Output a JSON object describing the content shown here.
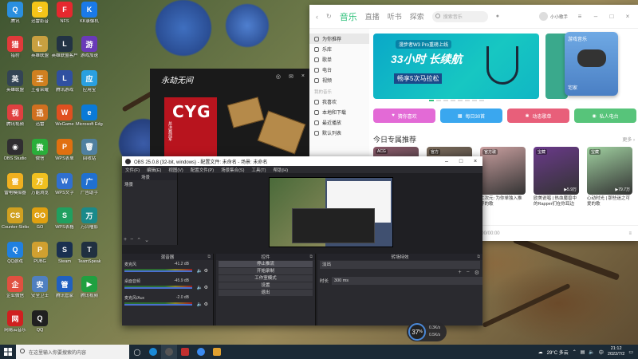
{
  "desktop": {
    "icons": [
      {
        "label": "腾讯",
        "color": "#2a8fe0",
        "glyph": "Q"
      },
      {
        "label": "迅雷影音",
        "color": "#f5c518",
        "glyph": "S"
      },
      {
        "label": "NFS",
        "color": "#e5282e",
        "glyph": "F"
      },
      {
        "label": "KK录像机",
        "color": "#1a7ae8",
        "glyph": "K"
      },
      {
        "label": "猎豹",
        "color": "#e03a3a",
        "glyph": "猎"
      },
      {
        "label": "英雄联盟",
        "color": "#c8a040",
        "glyph": "L"
      },
      {
        "label": "英雄联盟客户",
        "color": "#234",
        "glyph": "L"
      },
      {
        "label": "游戏加速",
        "color": "#6a3ab8",
        "glyph": "游"
      },
      {
        "label": "英雄联盟",
        "color": "#345",
        "glyph": "英"
      },
      {
        "label": "王者荣耀",
        "color": "#d08020",
        "glyph": "王"
      },
      {
        "label": "腾讯游戏",
        "color": "#3050a0",
        "glyph": "L"
      },
      {
        "label": "应用宝",
        "color": "#2aa0e0",
        "glyph": "应"
      },
      {
        "label": "腾讯视频",
        "color": "#e04040",
        "glyph": "视"
      },
      {
        "label": "迅雷",
        "color": "#d07020",
        "glyph": "迅"
      },
      {
        "label": "WeGame",
        "color": "#e05020",
        "glyph": "W"
      },
      {
        "label": "Microsoft Edge",
        "color": "#0a7ad8",
        "glyph": "e"
      },
      {
        "label": "OBS Studio",
        "color": "#302e31",
        "glyph": "◉"
      },
      {
        "label": "微信",
        "color": "#2aae3a",
        "glyph": "微"
      },
      {
        "label": "WPS表单",
        "color": "#e07010",
        "glyph": "P"
      },
      {
        "label": "回收站",
        "color": "#5080a0",
        "glyph": "🗑"
      },
      {
        "label": "雷电模拟器",
        "color": "#f0b020",
        "glyph": "雷"
      },
      {
        "label": "万能浏览",
        "color": "#f0c020",
        "glyph": "万"
      },
      {
        "label": "WPS文字",
        "color": "#3070d0",
        "glyph": "W"
      },
      {
        "label": "广告助手",
        "color": "#2070d0",
        "glyph": "广"
      },
      {
        "label": "Counter-Strike",
        "color": "#d0a020",
        "glyph": "CS"
      },
      {
        "label": "GO",
        "color": "#e0a010",
        "glyph": "GO"
      },
      {
        "label": "WPS表格",
        "color": "#20a060",
        "glyph": "S"
      },
      {
        "label": "万兴喵影",
        "color": "#1a8a8a",
        "glyph": "万"
      },
      {
        "label": "QQ游戏",
        "color": "#2080e0",
        "glyph": "Q"
      },
      {
        "label": "PUBG",
        "color": "#d0a030",
        "glyph": "P"
      },
      {
        "label": "Steam",
        "color": "#1a3050",
        "glyph": "S"
      },
      {
        "label": "TeamSpeak",
        "color": "#203040",
        "glyph": "T"
      },
      {
        "label": "企业微信",
        "color": "#e05040",
        "glyph": "企"
      },
      {
        "label": "安全卫士",
        "color": "#5080c0",
        "glyph": "安"
      },
      {
        "label": "腾讯管家",
        "color": "#2060c0",
        "glyph": "管"
      },
      {
        "label": "腾讯视频",
        "color": "#20a040",
        "glyph": "▶"
      },
      {
        "label": "网易云音乐",
        "color": "#d02020",
        "glyph": "网"
      },
      {
        "label": "QQ",
        "color": "#202020",
        "glyph": "Q"
      }
    ]
  },
  "music": {
    "tabs": [
      "音乐",
      "直播",
      "听书",
      "探索"
    ],
    "active_tab": "音乐",
    "search_placeholder": "搜索音乐",
    "user": "小小歌手",
    "sidebar": [
      {
        "label": "为你推荐",
        "active": true
      },
      {
        "label": "乐库"
      },
      {
        "label": "歌单"
      },
      {
        "label": "电台"
      },
      {
        "label": "视频"
      }
    ],
    "sidebar_section": "我的音乐",
    "sidebar2": [
      "我喜欢",
      "本地和下载",
      "最近播放",
      "默认列表"
    ],
    "banner": {
      "tag": "漫步者W3 Pro重磅上线",
      "headline": "33小时 长续航",
      "sub": "畅享5次马拉松"
    },
    "game_card": {
      "tag": "游戏音乐",
      "label": "宅家"
    },
    "quick": [
      {
        "label": "猜你喜欢",
        "color": "#e36ad6"
      },
      {
        "label": "每日30首",
        "color": "#3aa7ef"
      },
      {
        "label": "动态歌单",
        "color": "#e85f7a"
      },
      {
        "label": "私人电台",
        "color": "#57c47a"
      }
    ],
    "rec_title": "今日专属推荐",
    "rec_more": "更多 ›",
    "rec_cards": [
      {
        "tag": "ACG",
        "color": "#8a5a6a",
        "plays": "",
        "caption": ""
      },
      {
        "tag": "官方",
        "color": "#7a6a5a",
        "plays": "",
        "caption": ""
      },
      {
        "tag": "官方歌",
        "color": "#caa0a0",
        "plays": "",
        "caption": "二次元: 为你单独入推荐的歌"
      },
      {
        "tag": "宝藏",
        "color": "#6a3a8a",
        "plays": "▶5.9万",
        "caption": "欧美说唱 | 热血魔兽中的Rapper们在你耳边"
      },
      {
        "tag": "宝藏",
        "color": "#a0d0a0",
        "plays": "▶79.7万",
        "caption": "心动时光 | 那些迷之可爱的歌"
      }
    ],
    "player_time": "00:00/00:00"
  },
  "game_window": {
    "title": "永劫无间",
    "cyg_text": "CYG",
    "cyg_sub": "总决赛冠军"
  },
  "obs": {
    "title": "OBS 25.0.8 (32-bit, windows) - 配置文件: 未命名 - 场景: 未命名",
    "menu": [
      "文件(F)",
      "编辑(E)",
      "视图(V)",
      "配置文件(P)",
      "场景集合(S)",
      "工具(T)",
      "帮助(H)"
    ],
    "scenes_title": "场景",
    "scenes": [
      "场景"
    ],
    "sources_title": "来源",
    "mixer_title": "混音器",
    "mixer": [
      {
        "name": "麦克风",
        "db": "-41.2 dB"
      },
      {
        "name": "桌面音频",
        "db": "-45.9 dB"
      },
      {
        "name": "麦克风/Aux",
        "db": "-2.0 dB"
      }
    ],
    "controls_title": "控件",
    "controls": [
      "停止推流",
      "开始录制",
      "工作室模式",
      "设置",
      "退出"
    ],
    "transitions_title": "转场特效",
    "transition_value": "淡出",
    "duration_label": "时长",
    "duration_value": "300 ms"
  },
  "widget": {
    "percent": "37",
    "unit": "%",
    "up": "0.3K/s",
    "down": "0.5K/s"
  },
  "taskbar": {
    "search_placeholder": "在这里输入你要搜索的内容",
    "weather": "29°C 多云",
    "time": "21:12",
    "date": "2022/7/2"
  }
}
